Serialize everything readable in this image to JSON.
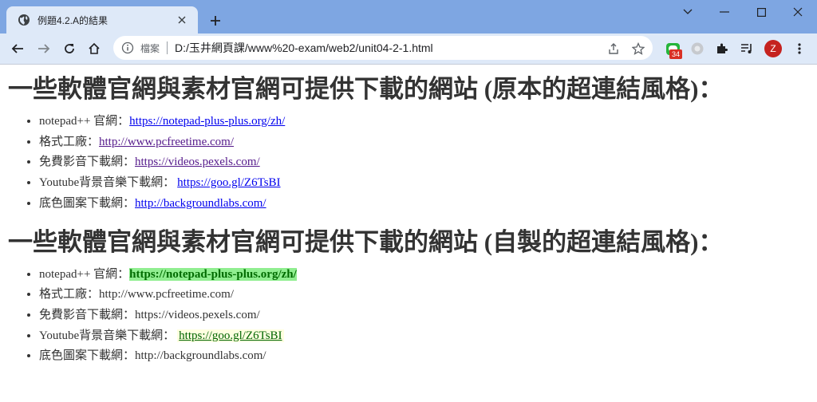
{
  "tab": {
    "title": "例題4.2.A的結果"
  },
  "omnibox": {
    "label": "檔案",
    "url": "D:/玉井網頁課/www%20-exam/web2/unit04-2-1.html"
  },
  "extensions": {
    "badge_count": "34"
  },
  "profile": {
    "initial": "Z",
    "color": "#c5221f"
  },
  "colors": {
    "tabstrip": "#7ea6e2",
    "toolbar": "#dee9f8",
    "link": "#0000ee",
    "visited": "#551a8b",
    "highlight": "#90ee90"
  },
  "section_original": {
    "heading": "一些軟體官網與素材官網可提供下載的網站 (原本的超連結風格)：",
    "items": [
      {
        "label": "notepad++ 官網：",
        "link": "https://notepad-plus-plus.org/zh/"
      },
      {
        "label": "格式工廠：",
        "link": "http://www.pcfreetime.com/"
      },
      {
        "label": "免費影音下載網：",
        "link": "https://videos.pexels.com/"
      },
      {
        "label": "Youtube背景音樂下載網：",
        "link": "https://goo.gl/Z6TsBI"
      },
      {
        "label": "底色圖案下載網：",
        "link": "http://backgroundlabs.com/"
      }
    ]
  },
  "section_custom": {
    "heading": "一些軟體官網與素材官網可提供下載的網站 (自製的超連結風格)：",
    "items": [
      {
        "label": "notepad++ 官網：",
        "link": "https://notepad-plus-plus.org/zh/"
      },
      {
        "label": "格式工廠：",
        "link": "http://www.pcfreetime.com/"
      },
      {
        "label": "免費影音下載網：",
        "link": "https://videos.pexels.com/"
      },
      {
        "label": "Youtube背景音樂下載網：",
        "link": "https://goo.gl/Z6TsBI"
      },
      {
        "label": "底色圖案下載網：",
        "link": "http://backgroundlabs.com/"
      }
    ]
  }
}
